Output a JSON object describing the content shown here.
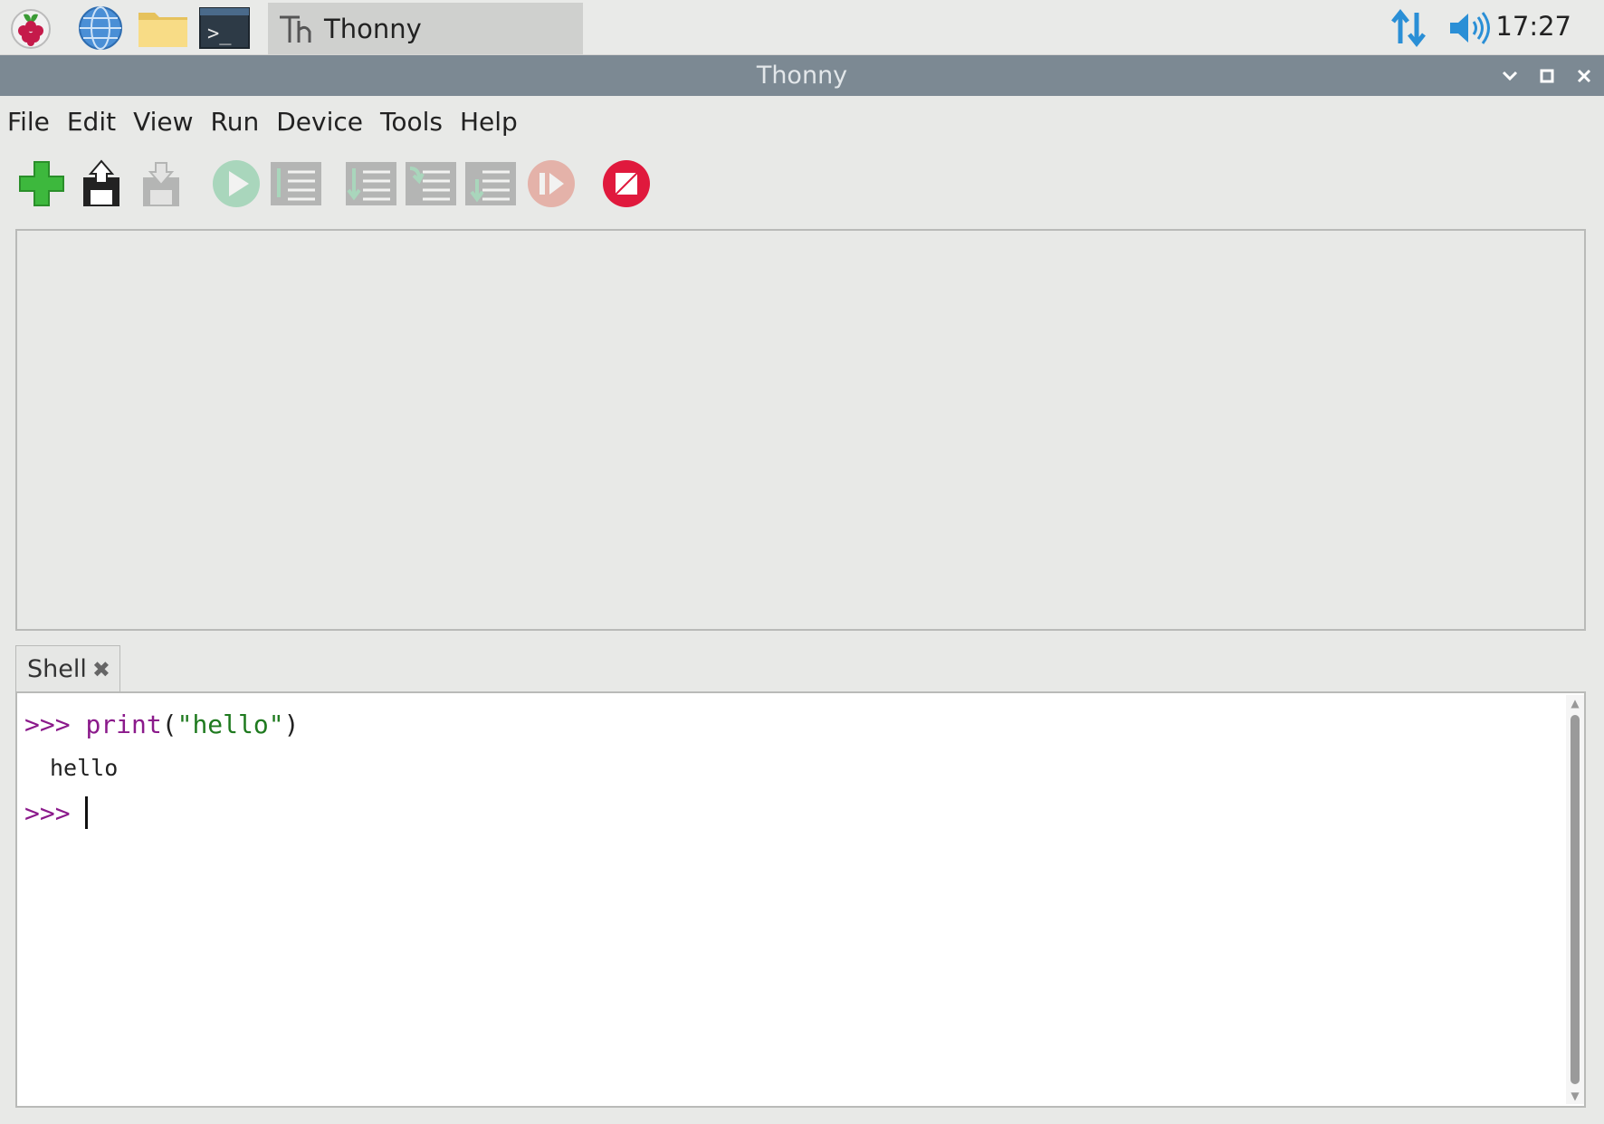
{
  "taskbar": {
    "launchers": [
      {
        "name": "raspberry-menu-icon"
      },
      {
        "name": "web-browser-icon"
      },
      {
        "name": "file-manager-icon"
      },
      {
        "name": "terminal-icon"
      }
    ],
    "active_task": {
      "label": "Thonny"
    },
    "tray": {
      "network_icon": "network-arrows-icon",
      "volume_icon": "speaker-icon",
      "clock": "17:27"
    }
  },
  "window": {
    "title": "Thonny",
    "controls": [
      "minimize",
      "maximize",
      "close"
    ]
  },
  "menu": {
    "items": [
      "File",
      "Edit",
      "View",
      "Run",
      "Device",
      "Tools",
      "Help"
    ]
  },
  "toolbar": {
    "buttons": [
      {
        "name": "new-file",
        "icon": "plus-icon",
        "enabled": true
      },
      {
        "name": "load-file",
        "icon": "load-icon",
        "enabled": true
      },
      {
        "name": "save-file",
        "icon": "save-icon",
        "enabled": false
      },
      {
        "name": "run",
        "icon": "play-icon",
        "enabled": false
      },
      {
        "name": "debug",
        "icon": "debug-icon",
        "enabled": false
      },
      {
        "name": "step-over",
        "icon": "step-over-icon",
        "enabled": false
      },
      {
        "name": "step-into",
        "icon": "step-into-icon",
        "enabled": false
      },
      {
        "name": "step-out",
        "icon": "step-out-icon",
        "enabled": false
      },
      {
        "name": "resume",
        "icon": "resume-icon",
        "enabled": false
      },
      {
        "name": "stop",
        "icon": "stop-icon",
        "enabled": true
      }
    ]
  },
  "shell": {
    "tab_label": "Shell",
    "tab_close": "✖",
    "lines": [
      {
        "prompt": ">>>",
        "keyword": "print",
        "open": "(",
        "string": "\"hello\"",
        "close": ")"
      },
      {
        "output": "hello"
      },
      {
        "prompt": ">>>"
      }
    ]
  },
  "colors": {
    "titlebar": "#7c8993",
    "prompt": "#8b1a8b",
    "string": "#1f7a1f",
    "stop": "#e0193d",
    "new_file": "#3db83d"
  }
}
